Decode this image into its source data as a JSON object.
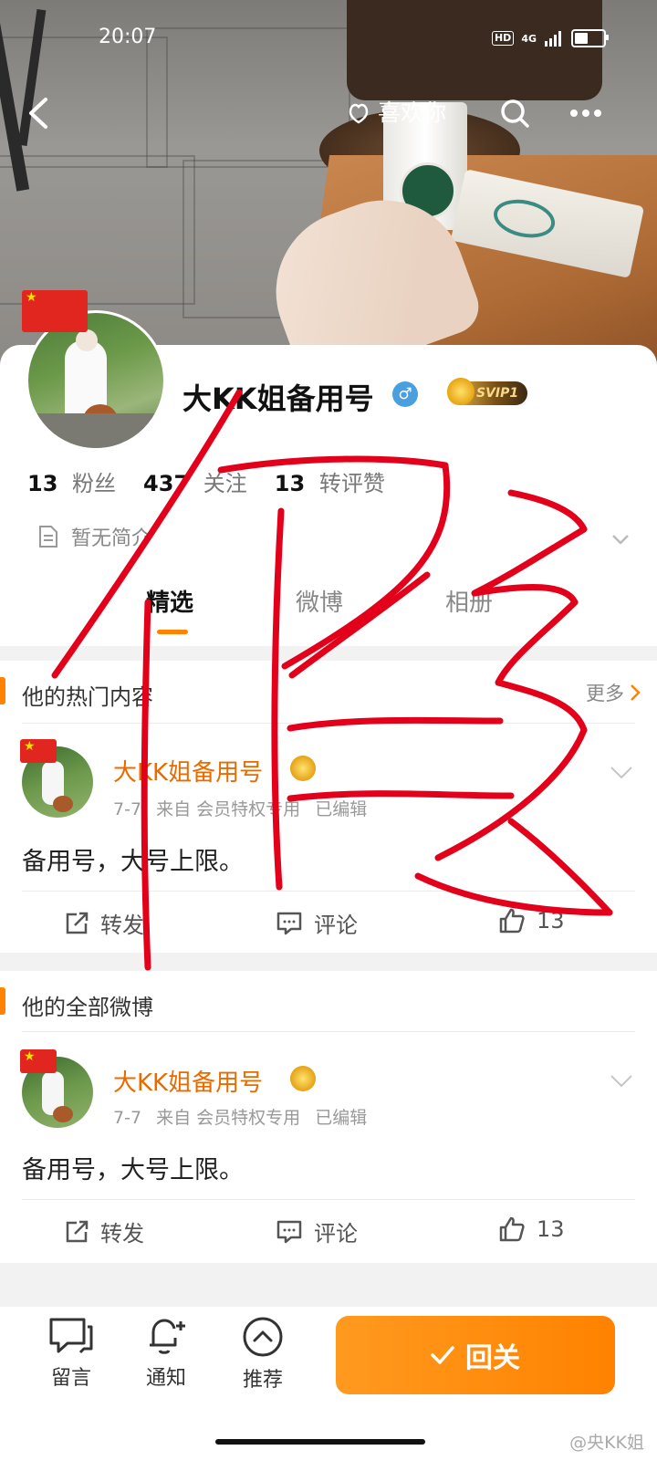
{
  "status_bar": {
    "time": "20:07",
    "hd": "HD",
    "network": "4G",
    "battery_level": 0.55
  },
  "top_nav": {
    "like_you_label": "喜欢你"
  },
  "profile": {
    "username": "大KK姐备用号",
    "gender": "♂",
    "vip_badge": "SVIP1",
    "stats": [
      {
        "value": "13",
        "label": "粉丝"
      },
      {
        "value": "437",
        "label": "关注"
      },
      {
        "value": "13",
        "label": "转评赞"
      }
    ],
    "bio": "暂无简介"
  },
  "tabs": [
    {
      "label": "精选",
      "active": true
    },
    {
      "label": "微博",
      "active": false
    },
    {
      "label": "相册",
      "active": false
    }
  ],
  "sections": {
    "hot": {
      "title": "他的热门内容",
      "more_label": "更多"
    },
    "all": {
      "title": "他的全部微博"
    }
  },
  "posts": [
    {
      "author": "大KK姐备用号",
      "date": "7-7",
      "source": "来自 会员特权专用",
      "edited": "已编辑",
      "text": "备用号，大号上限。",
      "repost_label": "转发",
      "comment_label": "评论",
      "like_count": "13"
    },
    {
      "author": "大KK姐备用号",
      "date": "7-7",
      "source": "来自 会员特权专用",
      "edited": "已编辑",
      "text": "备用号，大号上限。",
      "repost_label": "转发",
      "comment_label": "评论",
      "like_count": "13"
    }
  ],
  "bottom_bar": {
    "message_label": "留言",
    "notify_label": "通知",
    "recommend_label": "推荐",
    "follow_back_label": "回关"
  },
  "watermark": "@央KK姐",
  "colors": {
    "accent": "#ff8200",
    "name_orange": "#e86b00",
    "annotation_red": "#e3001b"
  }
}
